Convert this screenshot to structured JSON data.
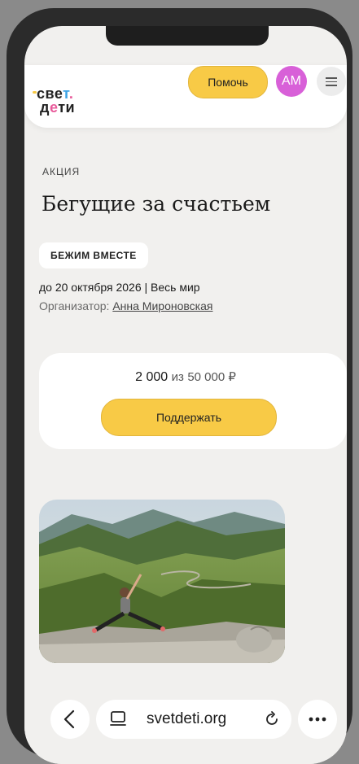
{
  "header": {
    "logo_line1_a": "св",
    "logo_line1_b": "е",
    "logo_line1_c": "т",
    "logo_line1_d": ".",
    "logo_line2_a": "д",
    "logo_line2_b": "е",
    "logo_line2_c": "ти",
    "help_label": "Помочь",
    "avatar_initials": "АМ",
    "menu_icon": "hamburger-icon"
  },
  "campaign": {
    "kicker": "АКЦИЯ",
    "title": "Бегущие за счастьем",
    "tag": "БЕЖИМ ВМЕСТЕ",
    "date_location": "до 20 октября 2026 | Весь мир",
    "organizer_prefix": "Организатор: ",
    "organizer_name": "Анна Мироновская"
  },
  "donation": {
    "raised": "2 000",
    "of_label": "из",
    "goal": "50 000 ₽",
    "progress_fraction": 0.04,
    "support_label": "Поддержать"
  },
  "browser": {
    "url": "svetdeti.org",
    "back_icon": "back-chevron-icon",
    "tabs_icon": "tabs-icon",
    "reload_icon": "reload-icon",
    "more_icon": "more-dots-icon"
  },
  "colors": {
    "accent_yellow": "#f8ca46",
    "avatar_purple": "#d860d8",
    "page_bg": "#f1f0ee"
  }
}
